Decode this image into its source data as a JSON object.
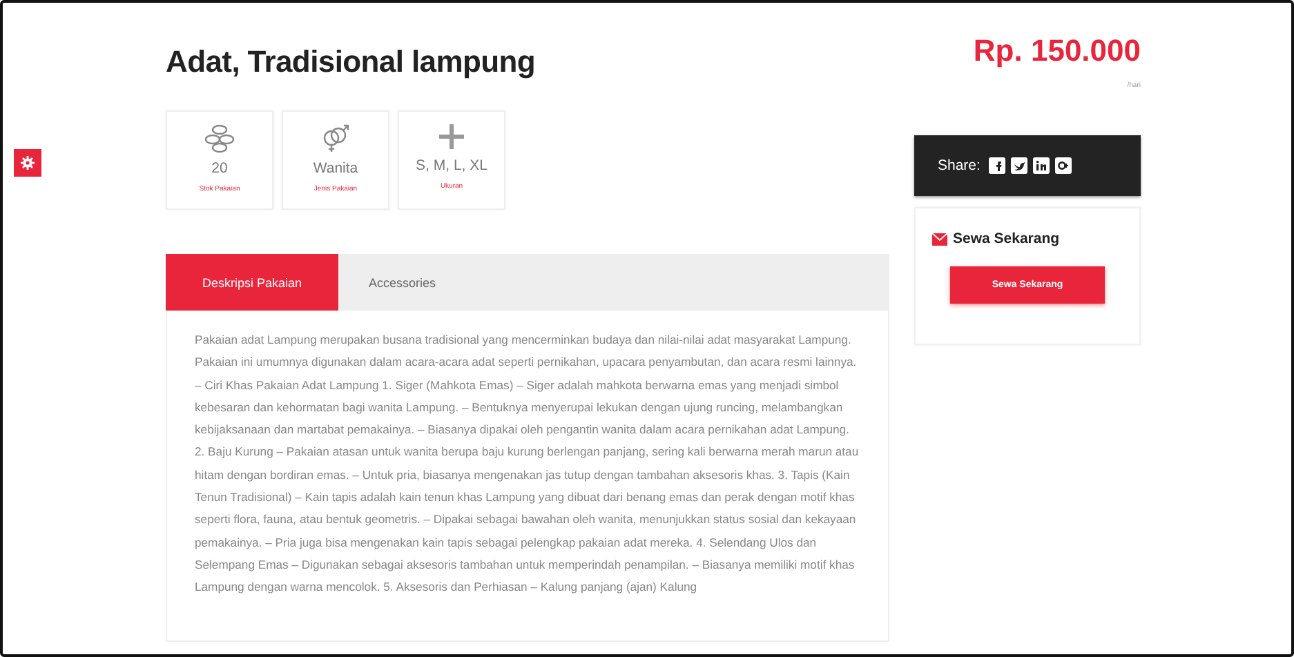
{
  "product": {
    "title": "Adat, Tradisional lampung",
    "price": "Rp. 150.000",
    "price_unit": "/hari"
  },
  "stats": [
    {
      "kind": "coins",
      "value": "20",
      "label": "Stok Pakaian"
    },
    {
      "kind": "gender",
      "value": "Wanita",
      "label": "Jenis Pakaian"
    },
    {
      "kind": "plus",
      "value": "S, M, L, XL",
      "label": "Ukuran"
    }
  ],
  "tabs": [
    {
      "label": "Deskripsi Pakaian",
      "selected": true
    },
    {
      "label": "Accessories",
      "selected": false
    }
  ],
  "description": "Pakaian adat Lampung merupakan busana tradisional yang mencerminkan budaya dan nilai-nilai adat masyarakat Lampung. Pakaian ini umumnya digunakan dalam acara-acara adat seperti pernikahan, upacara penyambutan, dan acara resmi lainnya. – Ciri Khas Pakaian Adat Lampung 1. Siger (Mahkota Emas) – Siger adalah mahkota berwarna emas yang menjadi simbol kebesaran dan kehormatan bagi wanita Lampung. – Bentuknya menyerupai lekukan dengan ujung runcing, melambangkan kebijaksanaan dan martabat pemakainya. – Biasanya dipakai oleh pengantin wanita dalam acara pernikahan adat Lampung. 2. Baju Kurung – Pakaian atasan untuk wanita berupa baju kurung berlengan panjang, sering kali berwarna merah marun atau hitam dengan bordiran emas. – Untuk pria, biasanya mengenakan jas tutup dengan tambahan aksesoris khas. 3. Tapis (Kain Tenun Tradisional) – Kain tapis adalah kain tenun khas Lampung yang dibuat dari benang emas dan perak dengan motif khas seperti flora, fauna, atau bentuk geometris. – Dipakai sebagai bawahan oleh wanita, menunjukkan status sosial dan kekayaan pemakainya. – Pria juga bisa mengenakan kain tapis sebagai pelengkap pakaian adat mereka. 4. Selendang Ulos dan Selempang Emas – Digunakan sebagai aksesoris tambahan untuk memperindah penampilan. – Biasanya memiliki motif khas Lampung dengan warna mencolok. 5. Aksesoris dan Perhiasan – Kalung panjang (ajan) Kalung",
  "share": {
    "label": "Share:",
    "networks": [
      {
        "kind": "facebook"
      },
      {
        "kind": "twitter"
      },
      {
        "kind": "linkedin"
      },
      {
        "kind": "google"
      }
    ]
  },
  "rent_card": {
    "title": "Sewa Sekarang",
    "button": "Sewa Sekarang"
  }
}
